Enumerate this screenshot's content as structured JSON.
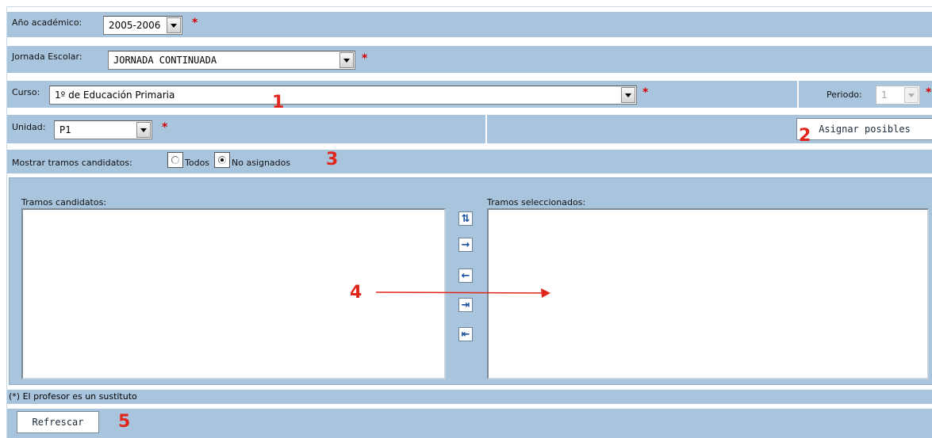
{
  "form": {
    "year": {
      "label": "Año académico:",
      "value": "2005-2006",
      "required": "*"
    },
    "jornada": {
      "label": "Jornada Escolar:",
      "value": "JORNADA CONTINUADA",
      "required": "*"
    },
    "curso": {
      "label": "Curso:",
      "value": "1º de Educación Primaria",
      "required": "*"
    },
    "periodo": {
      "label": "Periodo:",
      "value": "1",
      "required": "*"
    },
    "unidad": {
      "label": "Unidad:",
      "value": "P1",
      "required": "*"
    },
    "asignar_label": "Asignar posibles",
    "mostrar": {
      "label": "Mostrar tramos candidatos:",
      "options": [
        {
          "label": "Todos",
          "checked": false
        },
        {
          "label": "No asignados",
          "checked": true
        }
      ]
    },
    "candidatos_label": "Tramos candidatos:",
    "seleccionados_label": "Tramos seleccionados:",
    "move_buttons": [
      "swap-icon",
      "arrow-right-icon",
      "arrow-left-icon",
      "move-all-right-icon",
      "move-all-left-icon"
    ],
    "footnote": "(*) El profesor es un sustituto",
    "refresh_label": "Refrescar"
  },
  "annotations": [
    "1",
    "2",
    "3",
    "4",
    "5"
  ],
  "colors": {
    "band": "#a9c5de",
    "required": "#d40000",
    "annotation": "#e1261c"
  }
}
